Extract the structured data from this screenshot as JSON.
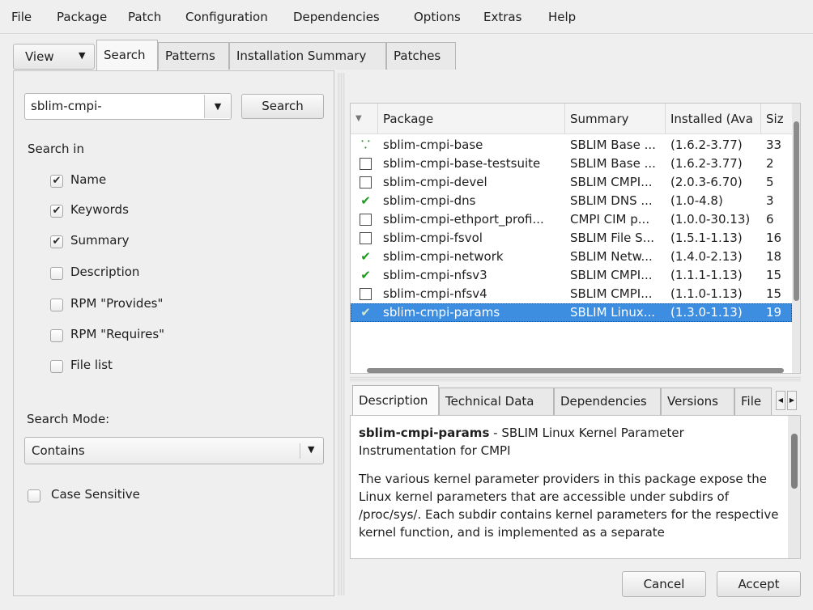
{
  "menu": [
    "File",
    "Package",
    "Patch",
    "Configuration",
    "Dependencies",
    "Options",
    "Extras",
    "Help"
  ],
  "view_button": "View",
  "main_tabs": [
    "Search",
    "Patterns",
    "Installation Summary",
    "Patches"
  ],
  "search": {
    "query": "sblim-cmpi-",
    "button": "Search",
    "search_in_label": "Search in",
    "options": [
      {
        "label": "Name",
        "checked": true
      },
      {
        "label": "Keywords",
        "checked": true
      },
      {
        "label": "Summary",
        "checked": true
      },
      {
        "label": "Description",
        "checked": false
      },
      {
        "label": "RPM \"Provides\"",
        "checked": false
      },
      {
        "label": "RPM \"Requires\"",
        "checked": false
      },
      {
        "label": "File list",
        "checked": false
      }
    ],
    "mode_label": "Search Mode:",
    "mode_value": "Contains",
    "case_sensitive_label": "Case Sensitive"
  },
  "package_table": {
    "columns": [
      "Package",
      "Summary",
      "Installed (Ava",
      "Siz"
    ],
    "rows": [
      {
        "status": "auto",
        "package": "sblim-cmpi-base",
        "summary": "SBLIM Base ...",
        "installed": "(1.6.2-3.77)",
        "size": "33"
      },
      {
        "status": "none",
        "package": "sblim-cmpi-base-testsuite",
        "summary": "SBLIM Base ...",
        "installed": "(1.6.2-3.77)",
        "size": "2"
      },
      {
        "status": "none",
        "package": "sblim-cmpi-devel",
        "summary": "SBLIM CMPI...",
        "installed": "(2.0.3-6.70)",
        "size": "5"
      },
      {
        "status": "installed",
        "package": "sblim-cmpi-dns",
        "summary": "SBLIM DNS ...",
        "installed": "(1.0-4.8)",
        "size": "3"
      },
      {
        "status": "none",
        "package": "sblim-cmpi-ethport_profi...",
        "summary": "CMPI CIM p...",
        "installed": "(1.0.0-30.13)",
        "size": "6"
      },
      {
        "status": "none",
        "package": "sblim-cmpi-fsvol",
        "summary": "SBLIM File S...",
        "installed": "(1.5.1-1.13)",
        "size": "16"
      },
      {
        "status": "installed",
        "package": "sblim-cmpi-network",
        "summary": "SBLIM Netw...",
        "installed": "(1.4.0-2.13)",
        "size": "18"
      },
      {
        "status": "installed",
        "package": "sblim-cmpi-nfsv3",
        "summary": "SBLIM CMPI...",
        "installed": "(1.1.1-1.13)",
        "size": "15"
      },
      {
        "status": "none",
        "package": "sblim-cmpi-nfsv4",
        "summary": "SBLIM CMPI...",
        "installed": "(1.1.0-1.13)",
        "size": "15"
      },
      {
        "status": "installed",
        "package": "sblim-cmpi-params",
        "summary": "SBLIM Linux...",
        "installed": "(1.3.0-1.13)",
        "size": "19",
        "selected": true
      }
    ]
  },
  "detail_tabs": [
    "Description",
    "Technical Data",
    "Dependencies",
    "Versions",
    "File"
  ],
  "description": {
    "name": "sblim-cmpi-params",
    "title_rest": " - SBLIM Linux Kernel Parameter Instrumentation for CMPI",
    "body": "The various kernel parameter providers in this package expose the Linux kernel parameters that are accessible under subdirs of /proc/sys/. Each subdir contains kernel parameters for the respective kernel function, and is implemented as a separate"
  },
  "buttons": {
    "cancel": "Cancel",
    "accept": "Accept"
  },
  "colors": {
    "selection": "#3d8ee0",
    "check_green": "#1f9b1f"
  }
}
